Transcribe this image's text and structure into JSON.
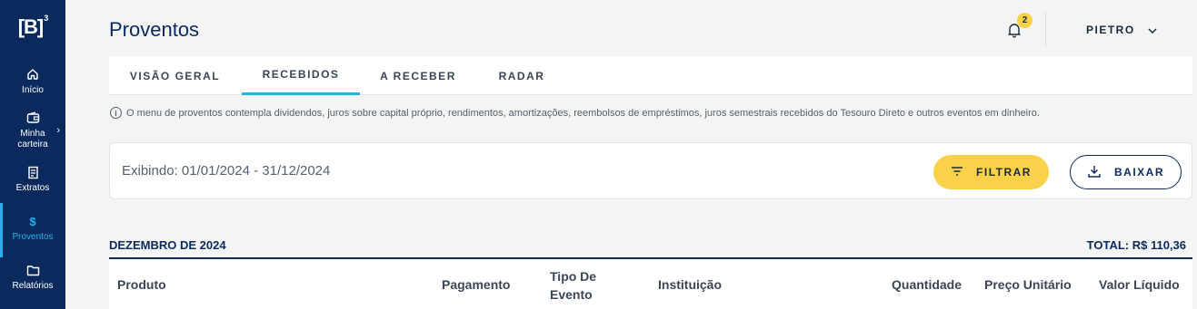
{
  "sidebar": {
    "logo_text": "[B]",
    "logo_sup": "3",
    "items": [
      {
        "label": "Início",
        "icon": "home-icon"
      },
      {
        "label": "Minha carteira",
        "icon": "wallet-icon"
      },
      {
        "label": "Extratos",
        "icon": "document-icon"
      },
      {
        "label": "Proventos",
        "icon": "dollar-icon",
        "active": true
      },
      {
        "label": "Relatórios",
        "icon": "folder-icon"
      }
    ]
  },
  "header": {
    "title": "Proventos",
    "notification_count": "2",
    "user_name": "PIETRO"
  },
  "tabs": [
    {
      "label": "VISÃO GERAL"
    },
    {
      "label": "RECEBIDOS",
      "active": true
    },
    {
      "label": "A RECEBER"
    },
    {
      "label": "RADAR"
    }
  ],
  "info_text": "O menu de proventos contempla dividendos, juros sobre capital próprio, rendimentos, amortizações, reembolsos de empréstimos, juros semestrais recebidos do Tesouro Direto e outros eventos em dinheiro.",
  "filter": {
    "showing": "Exibindo: 01/01/2024 - 31/12/2024",
    "filter_label": "FILTRAR",
    "download_label": "BAIXAR"
  },
  "section": {
    "month": "DEZEMBRO DE 2024",
    "total": "TOTAL: R$ 110,36"
  },
  "table": {
    "columns": [
      "Produto",
      "Pagamento",
      "Tipo De Evento",
      "Instituição",
      "Quantidade",
      "Preço Unitário",
      "Valor Líquido"
    ]
  },
  "colors": {
    "sidebar": "#0a2a5e",
    "accent": "#27b0ea",
    "primary_button": "#f9d24a"
  }
}
